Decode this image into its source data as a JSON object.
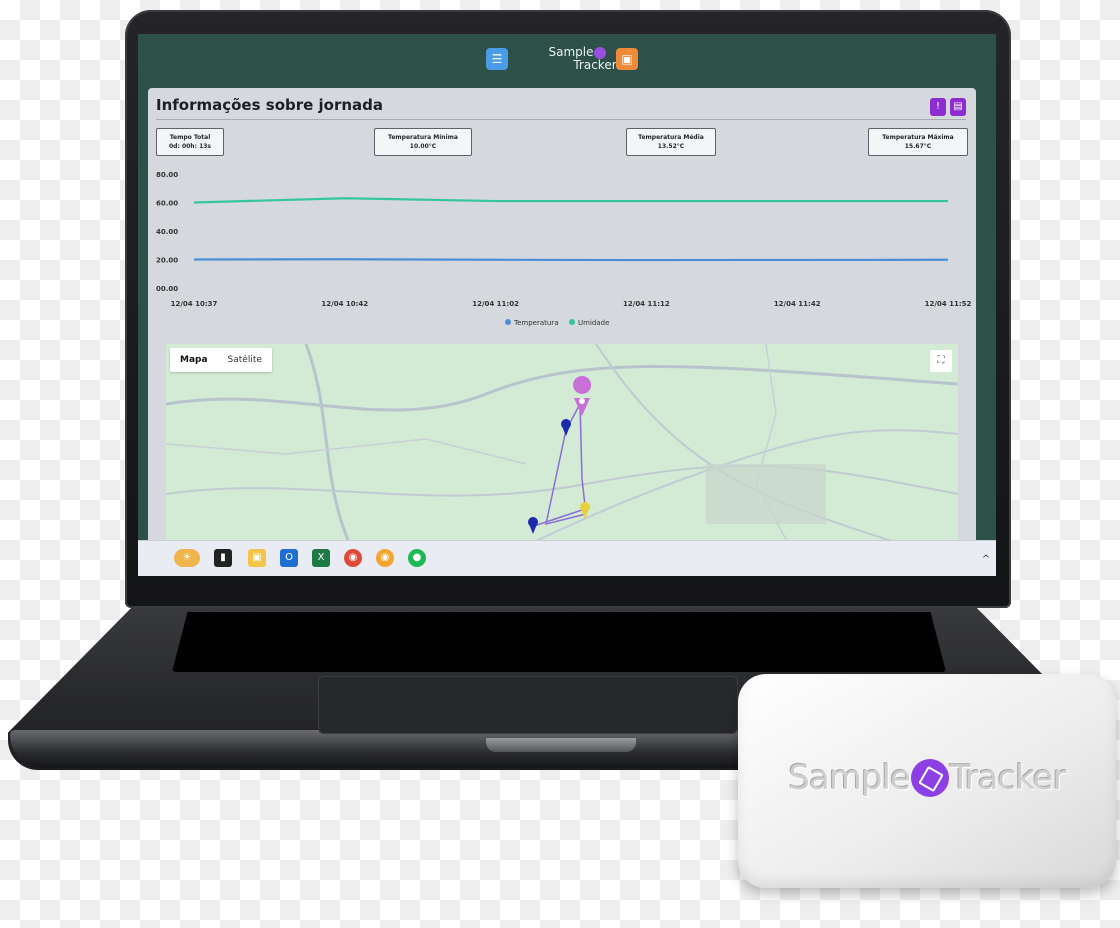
{
  "app": {
    "brand_line1": "Sample",
    "brand_line2": "Tracker"
  },
  "panel": {
    "title": "Informações sobre jornada",
    "stats": [
      {
        "label": "Tempo Total",
        "value": "0d: 00h: 13s"
      },
      {
        "label": "Temperatura Mínima",
        "value": "10.00°C"
      },
      {
        "label": "Temperatura Média",
        "value": "13.52°C"
      },
      {
        "label": "Temperatura Máxima",
        "value": "15.67°C"
      }
    ]
  },
  "chart_data": {
    "type": "line",
    "x": [
      "12/04 10:37",
      "12/04 10:42",
      "12/04 11:02",
      "12/04 11:12",
      "12/04 11:42",
      "12/04 11:52"
    ],
    "series": [
      {
        "name": "Temperatura",
        "color": "#4a90d9",
        "values": [
          20,
          20.2,
          19.8,
          19.6,
          19.7,
          19.8
        ]
      },
      {
        "name": "Umidade",
        "color": "#35c79a",
        "values": [
          60,
          63,
          61,
          61,
          61,
          61
        ]
      }
    ],
    "y_ticks": [
      "80.00",
      "60.00",
      "40.00",
      "20.00",
      "00.00"
    ],
    "ylim": [
      0,
      80
    ],
    "legend": "bottom-center",
    "grid": false
  },
  "map": {
    "tabs": [
      "Mapa",
      "Satélite"
    ],
    "active_tab": "Mapa"
  },
  "device": {
    "brand_left": "Sample",
    "brand_right": "Tracker"
  }
}
